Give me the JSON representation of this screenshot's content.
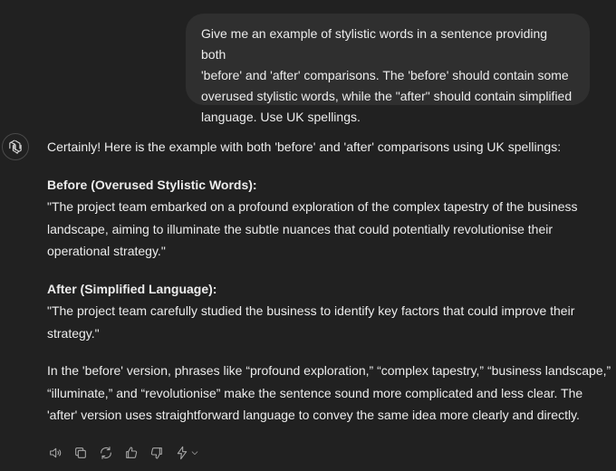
{
  "user_message": {
    "lines": [
      "Give me an example of stylistic words in a sentence providing both",
      "'before' and 'after' comparisons. The 'before' should contain some",
      "overused stylistic words, while the \"after\" should contain simplified",
      "language. Use UK spellings."
    ]
  },
  "assistant": {
    "avatar_icon": "openai-logo-icon",
    "intro": "Certainly! Here is the example with both 'before' and 'after' comparisons using UK spellings:",
    "before": {
      "heading": "Before (Overused Stylistic Words):",
      "text": "\"The project team embarked on a profound exploration of the complex tapestry of the business landscape, aiming to illuminate the subtle nuances that could potentially revolutionise their operational strategy.\""
    },
    "after": {
      "heading": "After (Simplified Language):",
      "text": "\"The project team carefully studied the business to identify key factors that could improve their strategy.\""
    },
    "summary": "In the 'before' version, phrases like “profound exploration,” “complex tapestry,” “business landscape,” “illuminate,” and “revolutionise” make the sentence sound more complicated and less clear. The 'after' version uses straightforward language to convey the same idea more clearly and directly."
  },
  "toolbar": {
    "icons": [
      "speaker-icon",
      "copy-icon",
      "regenerate-icon",
      "thumbs-up-icon",
      "thumbs-down-icon",
      "sparkle-model-icon"
    ]
  },
  "colors": {
    "background": "#212121",
    "bubble": "#2f2f2f",
    "text": "#ececec",
    "icon": "#a8a8a8"
  }
}
